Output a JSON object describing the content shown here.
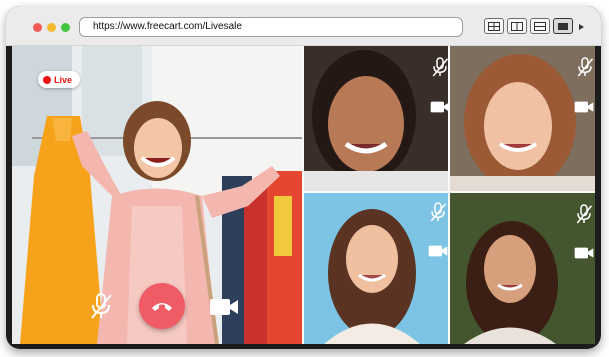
{
  "browser": {
    "url": "https://www.freecart.com/Livesale",
    "layout_buttons": [
      {
        "name": "grid-layout-icon",
        "active": false
      },
      {
        "name": "split-columns-layout-icon",
        "active": false
      },
      {
        "name": "split-rows-layout-icon",
        "active": false
      },
      {
        "name": "single-view-layout-icon",
        "active": true
      }
    ]
  },
  "main_stream": {
    "live_label": "Live",
    "live_color": "#e11111",
    "controls": {
      "mic": "mic-muted-icon",
      "end_call": "end-call-icon",
      "camera": "video-camera-icon"
    },
    "end_call_color": "#f05c66"
  },
  "participants": [
    {
      "mic": "mic-muted-icon",
      "camera": "video-camera-icon"
    },
    {
      "mic": "mic-muted-icon",
      "camera": "video-camera-icon"
    },
    {
      "mic": "mic-muted-icon",
      "camera": "video-camera-icon"
    },
    {
      "mic": "mic-muted-icon",
      "camera": "video-camera-icon"
    }
  ]
}
